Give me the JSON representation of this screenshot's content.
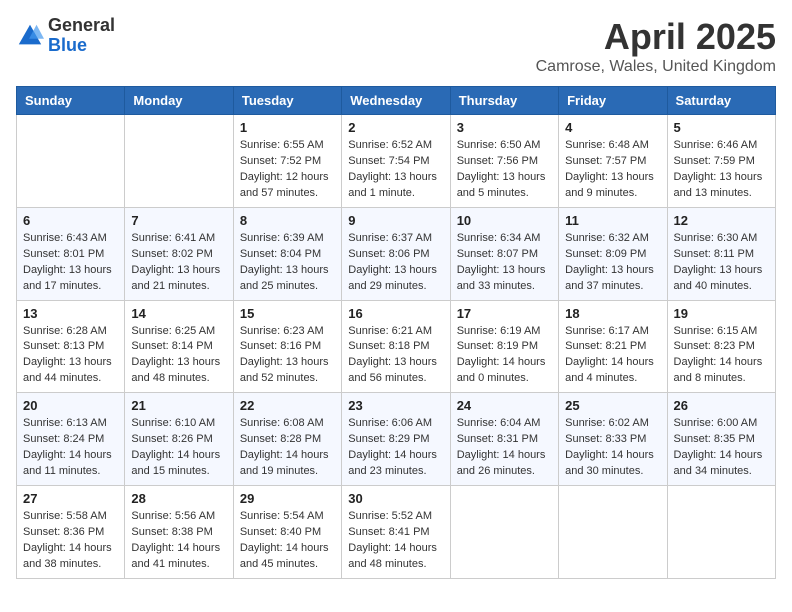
{
  "logo": {
    "general": "General",
    "blue": "Blue"
  },
  "title": {
    "month_year": "April 2025",
    "location": "Camrose, Wales, United Kingdom"
  },
  "weekdays": [
    "Sunday",
    "Monday",
    "Tuesday",
    "Wednesday",
    "Thursday",
    "Friday",
    "Saturday"
  ],
  "weeks": [
    [
      {
        "day": "",
        "info": ""
      },
      {
        "day": "",
        "info": ""
      },
      {
        "day": "1",
        "info": "Sunrise: 6:55 AM\nSunset: 7:52 PM\nDaylight: 12 hours\nand 57 minutes."
      },
      {
        "day": "2",
        "info": "Sunrise: 6:52 AM\nSunset: 7:54 PM\nDaylight: 13 hours\nand 1 minute."
      },
      {
        "day": "3",
        "info": "Sunrise: 6:50 AM\nSunset: 7:56 PM\nDaylight: 13 hours\nand 5 minutes."
      },
      {
        "day": "4",
        "info": "Sunrise: 6:48 AM\nSunset: 7:57 PM\nDaylight: 13 hours\nand 9 minutes."
      },
      {
        "day": "5",
        "info": "Sunrise: 6:46 AM\nSunset: 7:59 PM\nDaylight: 13 hours\nand 13 minutes."
      }
    ],
    [
      {
        "day": "6",
        "info": "Sunrise: 6:43 AM\nSunset: 8:01 PM\nDaylight: 13 hours\nand 17 minutes."
      },
      {
        "day": "7",
        "info": "Sunrise: 6:41 AM\nSunset: 8:02 PM\nDaylight: 13 hours\nand 21 minutes."
      },
      {
        "day": "8",
        "info": "Sunrise: 6:39 AM\nSunset: 8:04 PM\nDaylight: 13 hours\nand 25 minutes."
      },
      {
        "day": "9",
        "info": "Sunrise: 6:37 AM\nSunset: 8:06 PM\nDaylight: 13 hours\nand 29 minutes."
      },
      {
        "day": "10",
        "info": "Sunrise: 6:34 AM\nSunset: 8:07 PM\nDaylight: 13 hours\nand 33 minutes."
      },
      {
        "day": "11",
        "info": "Sunrise: 6:32 AM\nSunset: 8:09 PM\nDaylight: 13 hours\nand 37 minutes."
      },
      {
        "day": "12",
        "info": "Sunrise: 6:30 AM\nSunset: 8:11 PM\nDaylight: 13 hours\nand 40 minutes."
      }
    ],
    [
      {
        "day": "13",
        "info": "Sunrise: 6:28 AM\nSunset: 8:13 PM\nDaylight: 13 hours\nand 44 minutes."
      },
      {
        "day": "14",
        "info": "Sunrise: 6:25 AM\nSunset: 8:14 PM\nDaylight: 13 hours\nand 48 minutes."
      },
      {
        "day": "15",
        "info": "Sunrise: 6:23 AM\nSunset: 8:16 PM\nDaylight: 13 hours\nand 52 minutes."
      },
      {
        "day": "16",
        "info": "Sunrise: 6:21 AM\nSunset: 8:18 PM\nDaylight: 13 hours\nand 56 minutes."
      },
      {
        "day": "17",
        "info": "Sunrise: 6:19 AM\nSunset: 8:19 PM\nDaylight: 14 hours\nand 0 minutes."
      },
      {
        "day": "18",
        "info": "Sunrise: 6:17 AM\nSunset: 8:21 PM\nDaylight: 14 hours\nand 4 minutes."
      },
      {
        "day": "19",
        "info": "Sunrise: 6:15 AM\nSunset: 8:23 PM\nDaylight: 14 hours\nand 8 minutes."
      }
    ],
    [
      {
        "day": "20",
        "info": "Sunrise: 6:13 AM\nSunset: 8:24 PM\nDaylight: 14 hours\nand 11 minutes."
      },
      {
        "day": "21",
        "info": "Sunrise: 6:10 AM\nSunset: 8:26 PM\nDaylight: 14 hours\nand 15 minutes."
      },
      {
        "day": "22",
        "info": "Sunrise: 6:08 AM\nSunset: 8:28 PM\nDaylight: 14 hours\nand 19 minutes."
      },
      {
        "day": "23",
        "info": "Sunrise: 6:06 AM\nSunset: 8:29 PM\nDaylight: 14 hours\nand 23 minutes."
      },
      {
        "day": "24",
        "info": "Sunrise: 6:04 AM\nSunset: 8:31 PM\nDaylight: 14 hours\nand 26 minutes."
      },
      {
        "day": "25",
        "info": "Sunrise: 6:02 AM\nSunset: 8:33 PM\nDaylight: 14 hours\nand 30 minutes."
      },
      {
        "day": "26",
        "info": "Sunrise: 6:00 AM\nSunset: 8:35 PM\nDaylight: 14 hours\nand 34 minutes."
      }
    ],
    [
      {
        "day": "27",
        "info": "Sunrise: 5:58 AM\nSunset: 8:36 PM\nDaylight: 14 hours\nand 38 minutes."
      },
      {
        "day": "28",
        "info": "Sunrise: 5:56 AM\nSunset: 8:38 PM\nDaylight: 14 hours\nand 41 minutes."
      },
      {
        "day": "29",
        "info": "Sunrise: 5:54 AM\nSunset: 8:40 PM\nDaylight: 14 hours\nand 45 minutes."
      },
      {
        "day": "30",
        "info": "Sunrise: 5:52 AM\nSunset: 8:41 PM\nDaylight: 14 hours\nand 48 minutes."
      },
      {
        "day": "",
        "info": ""
      },
      {
        "day": "",
        "info": ""
      },
      {
        "day": "",
        "info": ""
      }
    ]
  ]
}
